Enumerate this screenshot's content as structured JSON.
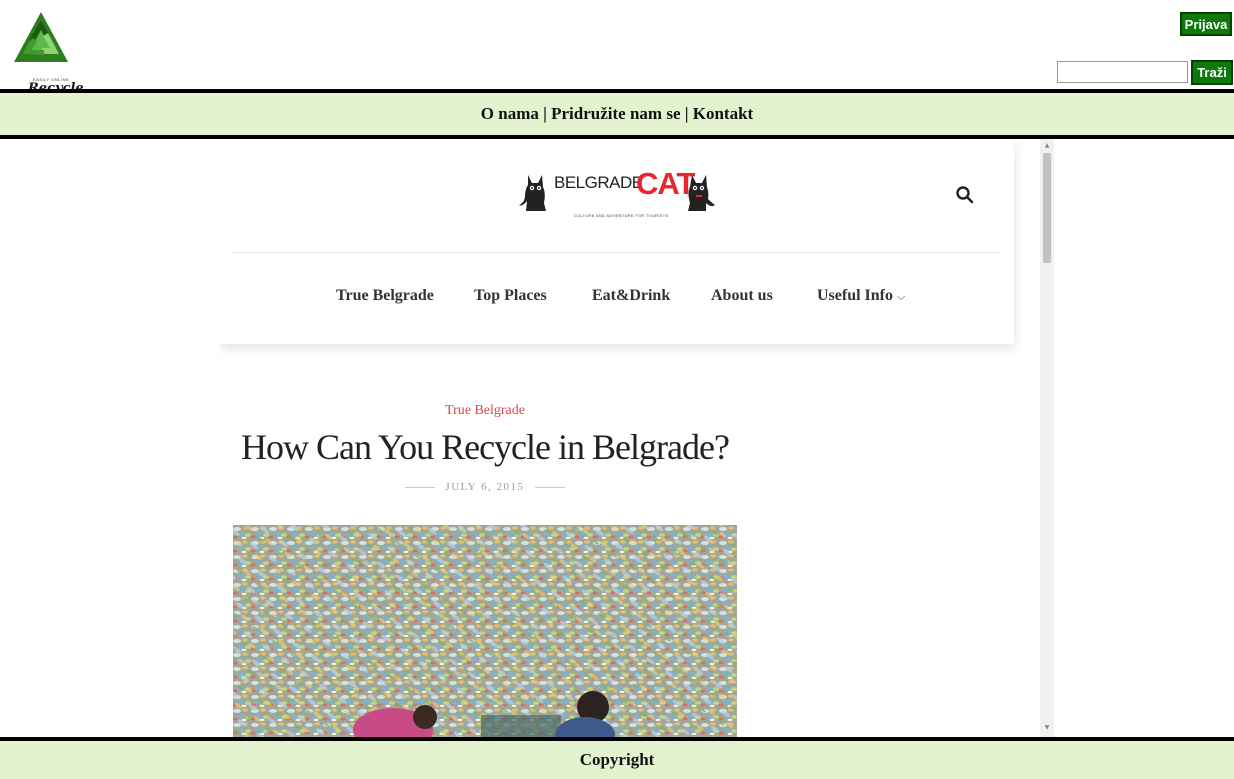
{
  "header": {
    "logo_small_text": "EASILY ONLINE",
    "logo_text": "Recycle",
    "login_label": "Prijava",
    "search_placeholder": "",
    "search_button_label": "Traži"
  },
  "nav": {
    "links": [
      "O nama",
      "Pridružite nam se",
      "Kontakt"
    ],
    "separator": " | "
  },
  "embedded_site": {
    "brand_word": "BELGRADE",
    "brand_cat": "CAT",
    "brand_tagline": "CULTURE AND ADVENTURE FOR TOURISTS",
    "menu": [
      "True Belgrade",
      "Top Places",
      "Eat&Drink",
      "About us",
      "Useful Info"
    ],
    "menu_dropdown_glyph": "⌵",
    "post": {
      "category": "True Belgrade",
      "title": "How Can You Recycle in Belgrade?",
      "date": "JULY 6, 2015"
    }
  },
  "footer": {
    "label": "Copyright"
  },
  "colors": {
    "accent_green": "#0b7a0b",
    "band_bg": "#e3f3cf",
    "category_red": "#e0454d",
    "brand_red": "#e8272f"
  },
  "icons": {
    "logo": "recycle-triangle-icon",
    "search": "magnifier-icon",
    "dropdown": "chevron-down-icon"
  }
}
